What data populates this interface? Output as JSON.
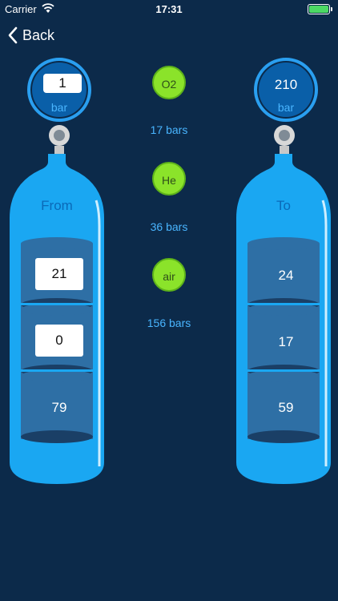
{
  "status": {
    "carrier": "Carrier",
    "time": "17:31"
  },
  "nav": {
    "back_label": "Back"
  },
  "from": {
    "title": "From",
    "pressure": "1",
    "unit": "bar",
    "segments": [
      "21",
      "0",
      "79"
    ]
  },
  "to": {
    "title": "To",
    "pressure": "210",
    "unit": "bar",
    "segments": [
      "24",
      "17",
      "59"
    ]
  },
  "gases": [
    {
      "name": "O2",
      "bars": "17 bars"
    },
    {
      "name": "He",
      "bars": "36 bars"
    },
    {
      "name": "air",
      "bars": "156 bars"
    }
  ],
  "colors": {
    "background": "#0c2a4a",
    "tank": "#1aa7f2",
    "gas_button": "#8be32a",
    "accent_text": "#49b5ff"
  }
}
